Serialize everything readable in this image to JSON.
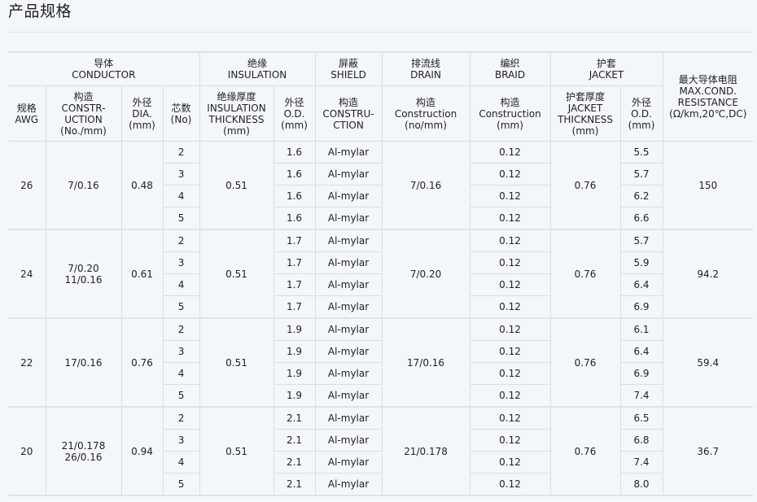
{
  "page": {
    "title": "产品规格"
  },
  "table": {
    "group_headers": [
      {
        "cn": "导体",
        "en": "CONDUCTOR"
      },
      {
        "cn": "绝缘",
        "en": "INSULATION"
      },
      {
        "cn": "屏蔽",
        "en": "SHIELD"
      },
      {
        "cn": "排流线",
        "en": "DRAIN"
      },
      {
        "cn": "编织",
        "en": "BRAID"
      },
      {
        "cn": "护套",
        "en": "JACKET"
      },
      {
        "cn": "最大导体电阻",
        "en": "MAX.COND.\nRESISTANCE\n(Ω/km,20℃,DC)"
      }
    ],
    "sub_headers": [
      {
        "cn": "规格",
        "en": "AWG"
      },
      {
        "cn": "构造",
        "en": "CONSTR-\nUCTION\n(No./mm)"
      },
      {
        "cn": "外径",
        "en": "DIA.\n(mm)"
      },
      {
        "cn": "芯数",
        "en": "(No)"
      },
      {
        "cn": "绝缘厚度",
        "en": "INSULATION\nTHICKNESS\n(mm)"
      },
      {
        "cn": "外径",
        "en": "O.D.\n(mm)"
      },
      {
        "cn": "构造",
        "en": "CONSTRU-\nCTION"
      },
      {
        "cn": "构造",
        "en": "Construction\n(no/mm)"
      },
      {
        "cn": "构造",
        "en": "Construction\n(mm)"
      },
      {
        "cn": "护套厚度",
        "en": "JACKET\nTHICKNESS\n(mm)"
      },
      {
        "cn": "外径",
        "en": "O.D.\n(mm)"
      }
    ],
    "groups": [
      {
        "awg": "26",
        "construction": "7/0.16",
        "dia": "0.48",
        "insulation_thickness": "0.51",
        "drain": "7/0.16",
        "jacket_thickness": "0.76",
        "resistance": "150",
        "rows": [
          {
            "cores": "2",
            "ins_od": "1.6",
            "shield": "Al-mylar",
            "braid": "0.12",
            "jacket_od": "5.5"
          },
          {
            "cores": "3",
            "ins_od": "1.6",
            "shield": "Al-mylar",
            "braid": "0.12",
            "jacket_od": "5.7"
          },
          {
            "cores": "4",
            "ins_od": "1.6",
            "shield": "Al-mylar",
            "braid": "0.12",
            "jacket_od": "6.2"
          },
          {
            "cores": "5",
            "ins_od": "1.6",
            "shield": "Al-mylar",
            "braid": "0.12",
            "jacket_od": "6.6"
          }
        ]
      },
      {
        "awg": "24",
        "construction": "7/0.20\n11/0.16",
        "dia": "0.61",
        "insulation_thickness": "0.51",
        "drain": "7/0.20",
        "jacket_thickness": "0.76",
        "resistance": "94.2",
        "rows": [
          {
            "cores": "2",
            "ins_od": "1.7",
            "shield": "Al-mylar",
            "braid": "0.12",
            "jacket_od": "5.7"
          },
          {
            "cores": "3",
            "ins_od": "1.7",
            "shield": "Al-mylar",
            "braid": "0.12",
            "jacket_od": "5.9"
          },
          {
            "cores": "4",
            "ins_od": "1.7",
            "shield": "Al-mylar",
            "braid": "0.12",
            "jacket_od": "6.4"
          },
          {
            "cores": "5",
            "ins_od": "1.7",
            "shield": "Al-mylar",
            "braid": "0.12",
            "jacket_od": "6.9"
          }
        ]
      },
      {
        "awg": "22",
        "construction": "17/0.16",
        "dia": "0.76",
        "insulation_thickness": "0.51",
        "drain": "17/0.16",
        "jacket_thickness": "0.76",
        "resistance": "59.4",
        "rows": [
          {
            "cores": "2",
            "ins_od": "1.9",
            "shield": "Al-mylar",
            "braid": "0.12",
            "jacket_od": "6.1"
          },
          {
            "cores": "3",
            "ins_od": "1.9",
            "shield": "Al-mylar",
            "braid": "0.12",
            "jacket_od": "6.4"
          },
          {
            "cores": "4",
            "ins_od": "1.9",
            "shield": "Al-mylar",
            "braid": "0.12",
            "jacket_od": "6.9"
          },
          {
            "cores": "5",
            "ins_od": "1.9",
            "shield": "Al-mylar",
            "braid": "0.12",
            "jacket_od": "7.4"
          }
        ]
      },
      {
        "awg": "20",
        "construction": "21/0.178\n26/0.16",
        "dia": "0.94",
        "insulation_thickness": "0.51",
        "drain": "21/0.178",
        "jacket_thickness": "0.76",
        "resistance": "36.7",
        "rows": [
          {
            "cores": "2",
            "ins_od": "2.1",
            "shield": "Al-mylar",
            "braid": "0.12",
            "jacket_od": "6.5"
          },
          {
            "cores": "3",
            "ins_od": "2.1",
            "shield": "Al-mylar",
            "braid": "0.12",
            "jacket_od": "6.8"
          },
          {
            "cores": "4",
            "ins_od": "2.1",
            "shield": "Al-mylar",
            "braid": "0.12",
            "jacket_od": "7.4"
          },
          {
            "cores": "5",
            "ins_od": "2.1",
            "shield": "Al-mylar",
            "braid": "0.12",
            "jacket_od": "8.0"
          }
        ]
      }
    ]
  }
}
